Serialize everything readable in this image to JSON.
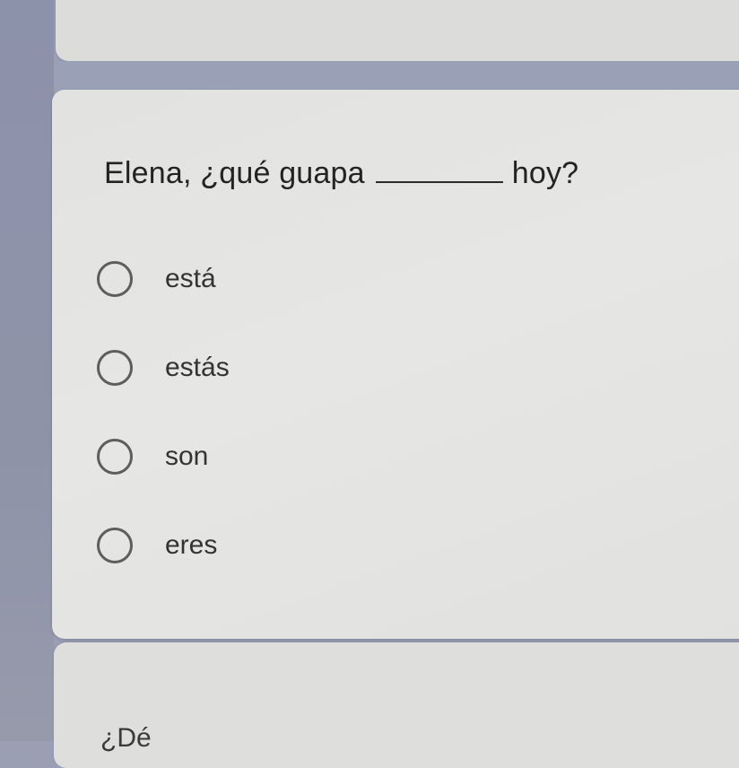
{
  "question": {
    "before_blank": "Elena, ¿qué guapa",
    "after_blank": "hoy?"
  },
  "options": [
    {
      "label": "está",
      "selected": false
    },
    {
      "label": "estás",
      "selected": false
    },
    {
      "label": "son",
      "selected": false
    },
    {
      "label": "eres",
      "selected": false
    }
  ],
  "next_question_partial": "¿Dé"
}
